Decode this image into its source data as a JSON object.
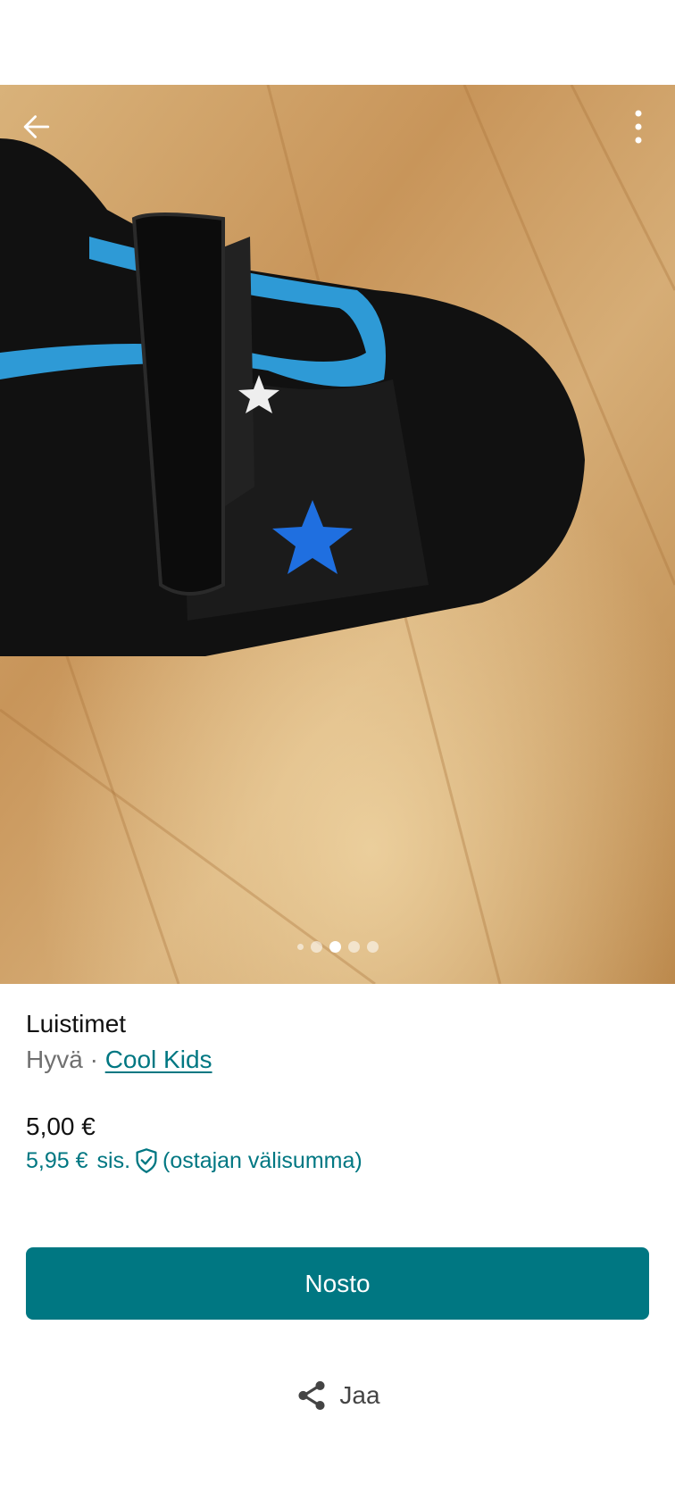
{
  "header": {
    "back_icon": "arrow-left-icon",
    "menu_icon": "more-vertical-icon"
  },
  "gallery": {
    "photo_count": 5,
    "active_index": 2
  },
  "item": {
    "title": "Luistimet",
    "condition": "Hyvä",
    "separator": " · ",
    "brand": "Cool Kids"
  },
  "pricing": {
    "price": "5,00 €",
    "total_amount": "5,95 €",
    "incl_label": "sis.",
    "incl_icon": "shield-check-icon",
    "note": "(ostajan välisumma)"
  },
  "actions": {
    "primary_label": "Nosto",
    "share_label": "Jaa",
    "share_icon": "share-icon"
  },
  "colors": {
    "accent": "#007782",
    "text": "#111111",
    "muted": "#707070"
  }
}
